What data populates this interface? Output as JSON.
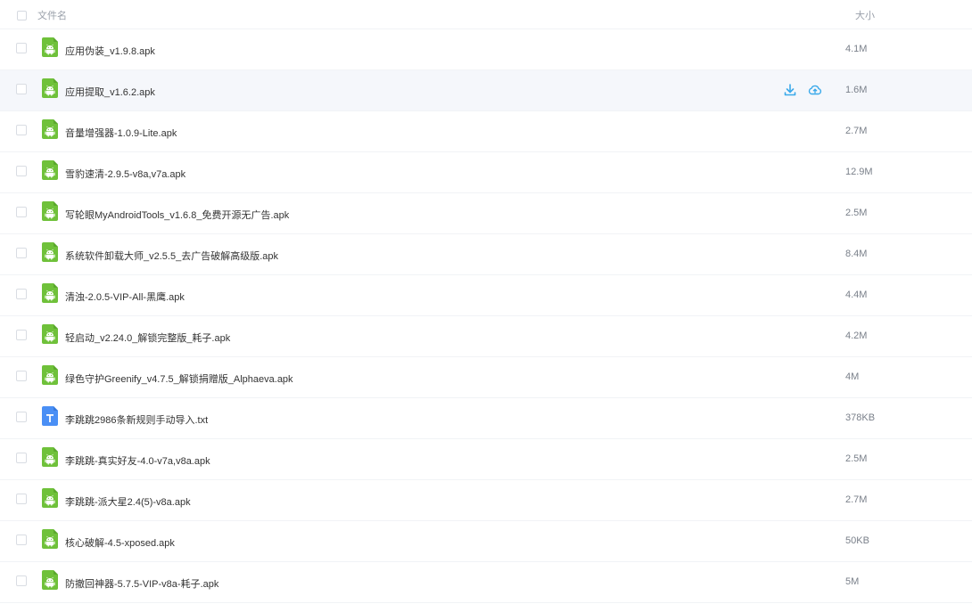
{
  "header": {
    "name_label": "文件名",
    "size_label": "大小"
  },
  "colors": {
    "apk_icon": "#6fc13a",
    "txt_icon": "#4a8ff5",
    "action_icon": "#3aa9ea"
  },
  "files": [
    {
      "name": "应用伪装_v1.9.8.apk",
      "size": "4.1M",
      "type": "apk",
      "icon": "android-file-icon",
      "hover": false
    },
    {
      "name": "应用提取_v1.6.2.apk",
      "size": "1.6M",
      "type": "apk",
      "icon": "android-file-icon",
      "hover": true
    },
    {
      "name": "音量增强器-1.0.9-Lite.apk",
      "size": "2.7M",
      "type": "apk",
      "icon": "android-file-icon",
      "hover": false
    },
    {
      "name": "雪豹速清-2.9.5-v8a,v7a.apk",
      "size": "12.9M",
      "type": "apk",
      "icon": "android-file-icon",
      "hover": false
    },
    {
      "name": "写轮眼MyAndroidTools_v1.6.8_免费开源无广告.apk",
      "size": "2.5M",
      "type": "apk",
      "icon": "android-file-icon",
      "hover": false
    },
    {
      "name": "系统软件卸载大师_v2.5.5_去广告破解高级版.apk",
      "size": "8.4M",
      "type": "apk",
      "icon": "android-file-icon",
      "hover": false
    },
    {
      "name": "清浊-2.0.5-VIP-All-黑鹰.apk",
      "size": "4.4M",
      "type": "apk",
      "icon": "android-file-icon",
      "hover": false
    },
    {
      "name": "轻启动_v2.24.0_解锁完整版_耗子.apk",
      "size": "4.2M",
      "type": "apk",
      "icon": "android-file-icon",
      "hover": false
    },
    {
      "name": "绿色守护Greenify_v4.7.5_解锁捐赠版_Alphaeva.apk",
      "size": "4M",
      "type": "apk",
      "icon": "android-file-icon",
      "hover": false
    },
    {
      "name": "李跳跳2986条新规则手动导入.txt",
      "size": "378KB",
      "type": "txt",
      "icon": "text-file-icon",
      "hover": false
    },
    {
      "name": "李跳跳-真实好友-4.0-v7a,v8a.apk",
      "size": "2.5M",
      "type": "apk",
      "icon": "android-file-icon",
      "hover": false
    },
    {
      "name": "李跳跳-派大星2.4(5)-v8a.apk",
      "size": "2.7M",
      "type": "apk",
      "icon": "android-file-icon",
      "hover": false
    },
    {
      "name": "核心破解-4.5-xposed.apk",
      "size": "50KB",
      "type": "apk",
      "icon": "android-file-icon",
      "hover": false
    },
    {
      "name": "防撤回神器-5.7.5-VIP-v8a-耗子.apk",
      "size": "5M",
      "type": "apk",
      "icon": "android-file-icon",
      "hover": false
    }
  ]
}
